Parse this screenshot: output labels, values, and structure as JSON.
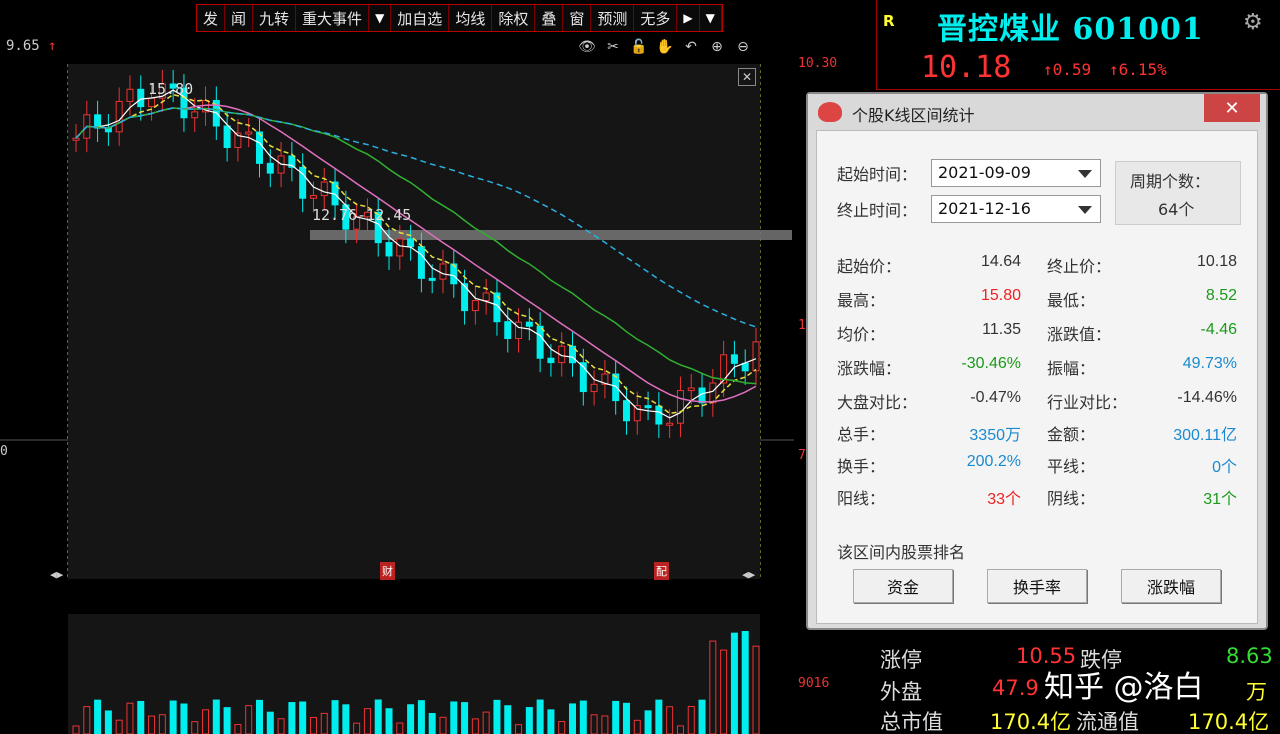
{
  "toolbar": {
    "items": [
      "发",
      "闻",
      "九转",
      "重大事件",
      "▼",
      "加自选",
      "均线",
      "除权",
      "叠",
      "窗",
      "预测",
      "无多",
      "▶",
      "▼"
    ]
  },
  "chart": {
    "top_left_price": "9.65",
    "top_left_arrow": "↑",
    "high_label": "15.80",
    "range_label": "12.76-12.45",
    "axis_right_label": "10.30",
    "axis_right_mid": "1",
    "axis_right_low": "7",
    "axis_left_zero": "0",
    "vol_axis_label": "9016",
    "icons": [
      "eye-icon",
      "scissors-icon",
      "lock-icon",
      "hand-icon",
      "undo-icon",
      "zoom-in-icon",
      "zoom-out-icon"
    ],
    "icon_glyphs": [
      "👁",
      "✂",
      "🔓",
      "✋",
      "↶",
      "⊕",
      "⊖"
    ],
    "marker_left": "财",
    "marker_right": "配",
    "nav_left": "◀▶",
    "nav_right": "◀▶",
    "close_x": "✕"
  },
  "chart_data": {
    "type": "candlestick",
    "start": "2021-09-09",
    "end": "2021-12-16",
    "high": 15.8,
    "low": 8.52,
    "open": 14.64,
    "close": 10.18
  },
  "quote": {
    "r_label": "R",
    "name": "晋控煤业 601001",
    "price": "10.18",
    "change": "↑0.59",
    "pct": "↑6.15%"
  },
  "bottom_table": {
    "row1_left": "涨停",
    "row1_mid": "10.55",
    "row1_label": "跌停",
    "row1_val": "8.63",
    "row2_left": "外盘",
    "row2_mid": "47.9",
    "row2_val": "万",
    "row3_left": "总市值",
    "row3_mid": "170.4亿",
    "row3_label": "流通值",
    "row3_val": "170.4亿"
  },
  "dialog": {
    "title": "个股K线区间统计",
    "close": "✕",
    "start_label": "起始时间：",
    "start_value": "2021-09-09",
    "end_label": "终止时间：",
    "end_value": "2021-12-16",
    "count_label": "周期个数：",
    "count_value": "64个",
    "stats_left": [
      {
        "label": "起始价：",
        "value": "14.64",
        "color": "dark"
      },
      {
        "label": "最高：",
        "value": "15.80",
        "color": "red"
      },
      {
        "label": "均价：",
        "value": "11.35",
        "color": "dark"
      },
      {
        "label": "涨跌幅：",
        "value": "-30.46%",
        "color": "green"
      },
      {
        "label": "大盘对比：",
        "value": "-0.47%",
        "color": "dark"
      },
      {
        "label": "总手：",
        "value": "3350万",
        "color": "blue"
      },
      {
        "label": "换手：",
        "value": "200.2%",
        "color": "blue"
      },
      {
        "label": "阳线：",
        "value": "33个",
        "color": "red"
      }
    ],
    "stats_right": [
      {
        "label": "终止价：",
        "value": "10.18",
        "color": "dark"
      },
      {
        "label": "最低：",
        "value": "8.52",
        "color": "green"
      },
      {
        "label": "涨跌值：",
        "value": "-4.46",
        "color": "green"
      },
      {
        "label": "振幅：",
        "value": "49.73%",
        "color": "blue"
      },
      {
        "label": "行业对比：",
        "value": "-14.46%",
        "color": "dark"
      },
      {
        "label": "金额：",
        "value": "300.11亿",
        "color": "blue"
      },
      {
        "label": "平线：",
        "value": "0个",
        "color": "blue"
      },
      {
        "label": "阴线：",
        "value": "31个",
        "color": "green"
      }
    ],
    "ranking_label": "该区间内股票排名",
    "buttons": [
      "资金",
      "换手率",
      "涨跌幅"
    ]
  },
  "watermark": "知乎 @洛白",
  "colors": {
    "up": "#e33",
    "down": "#0ee",
    "accent": "#00e5ff"
  }
}
